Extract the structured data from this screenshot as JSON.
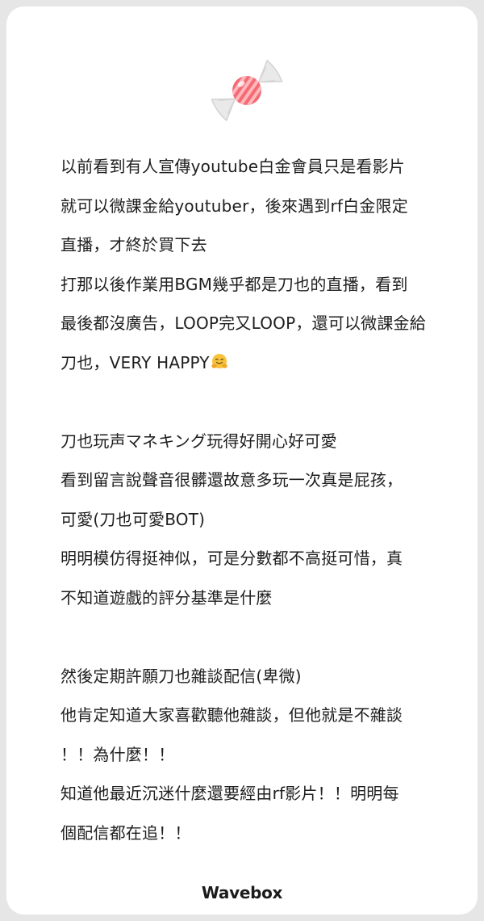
{
  "card": {
    "icon": "candy-icon",
    "lines": [
      "以前看到有人宣傳youtube白金會員只是看影片",
      "就可以微課金給youtuber，後來遇到rf白金限定",
      "直播，才終於買下去",
      "打那以後作業用BGM幾乎都是刀也的直播，看到",
      "最後都沒廣告，LOOP完又LOOP，還可以微課金給",
      "刀也，VERY HAPPY",
      "",
      "刀也玩声マネキング玩得好開心好可愛",
      "看到留言說聲音很髒還故意多玩一次真是屁孩，",
      "可愛(刀也可愛BOT)",
      "明明模仿得挺神似，可是分數都不高挺可惜，真",
      "不知道遊戲的評分基準是什麼",
      "",
      "然後定期許願刀也雜談配信(卑微)",
      "他肯定知道大家喜歡聽他雜談，但他就是不雜談",
      "！！為什麼！！",
      "知道他最近沉迷什麼還要經由rf影片！！明明每",
      "個配信都在追！！"
    ],
    "emoji": "hugging-face-emoji"
  },
  "footer": {
    "brand": "Wavebox"
  },
  "colors": {
    "background": "#e6e6e6",
    "card": "#ffffff",
    "text": "#1e1e1e",
    "candy_red": "#f0646e",
    "candy_wrapper": "#dcdcdc"
  }
}
